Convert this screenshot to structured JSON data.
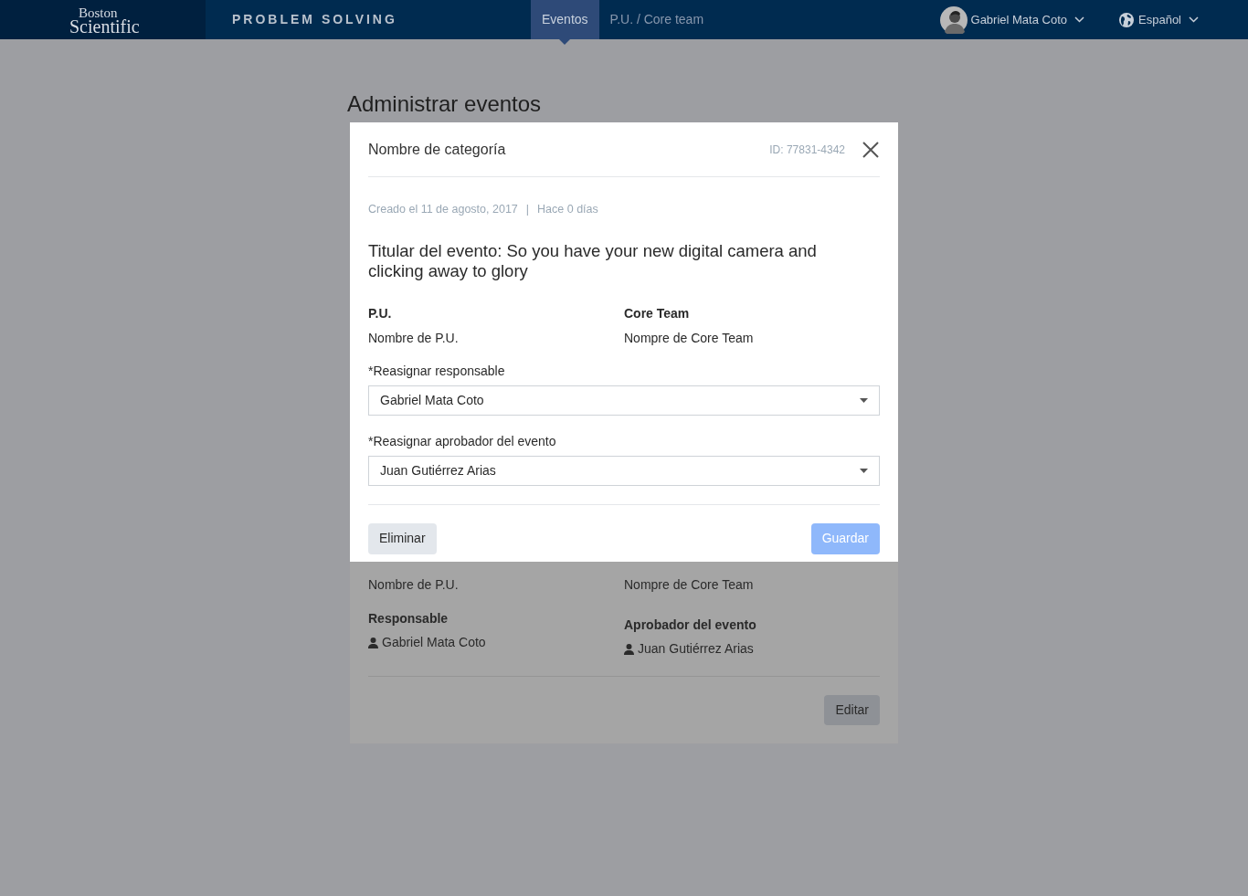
{
  "header": {
    "logo": {
      "line1": "Boston",
      "line2": "Scientific"
    },
    "app_title": "PROBLEM SOLVING",
    "nav": [
      {
        "label": "Eventos",
        "selected": true
      },
      {
        "label": "P.U. / Core team",
        "selected": false
      }
    ],
    "user": {
      "name": "Gabriel Mata Coto"
    },
    "language": {
      "label": "Español"
    }
  },
  "page": {
    "title": "Administrar eventos"
  },
  "event_card": {
    "pu": {
      "value": "Nombre de P.U."
    },
    "core_team": {
      "value": "Nompre de Core Team"
    },
    "responsible": {
      "label": "Responsable",
      "value": "Gabriel Mata Coto"
    },
    "approver": {
      "label": "Aprobador del evento",
      "value": "Juan Gutiérrez Arias"
    },
    "edit_button": "Editar"
  },
  "modal": {
    "category": "Nombre de categoría",
    "id": "ID: 77831-4342",
    "created": "Creado el 11 de agosto, 2017",
    "separator": "|",
    "age": "Hace 0 días",
    "headline": "Titular del evento: So you have your new digital camera and clicking away to glory",
    "info": [
      {
        "label": "P.U.",
        "value": "Nombre de P.U."
      },
      {
        "label": "Core Team",
        "value": "Nompre de Core Team"
      }
    ],
    "selects": [
      {
        "label": "*Reasignar responsable",
        "value": "Gabriel Mata Coto"
      },
      {
        "label": "*Reasignar aprobador del evento",
        "value": "Juan Gutiérrez Arias"
      }
    ],
    "delete_button": "Eliminar",
    "save_button": {
      "label": "Guardar",
      "disabled": true
    }
  }
}
